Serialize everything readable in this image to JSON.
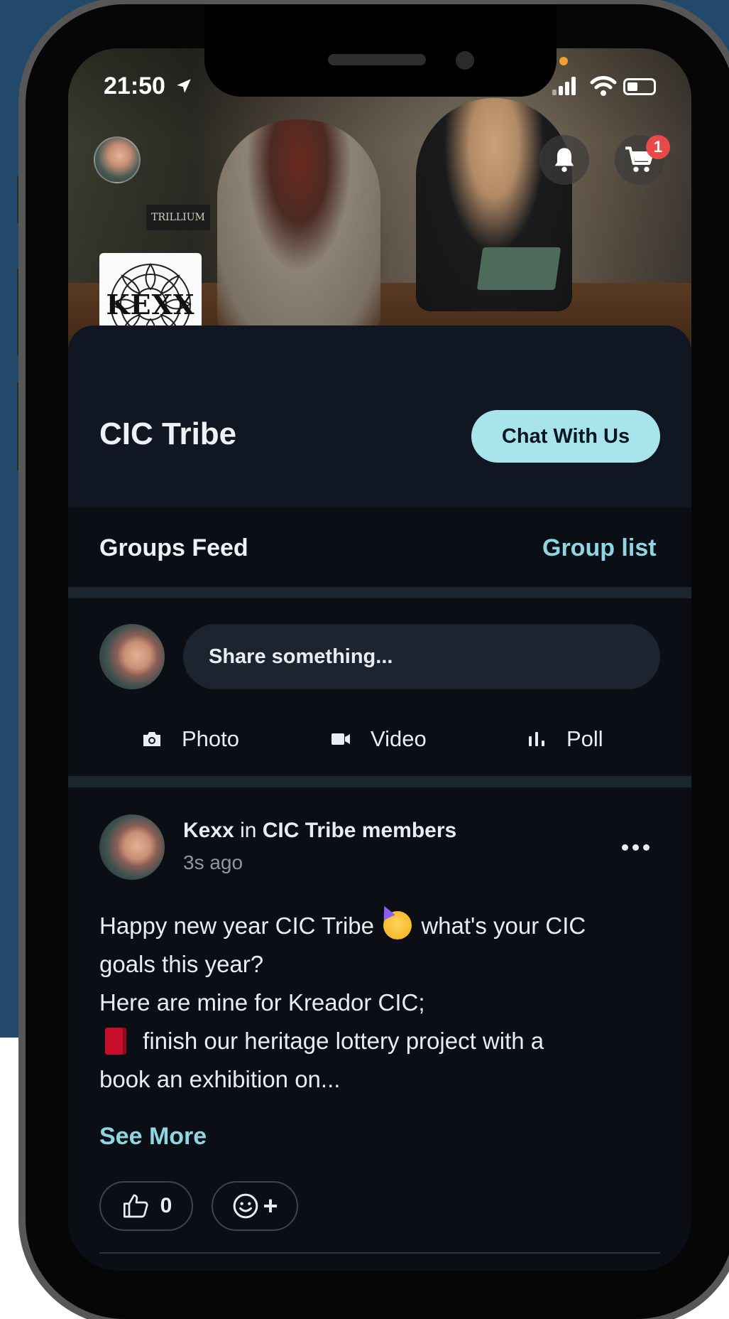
{
  "status_bar": {
    "time": "21:50"
  },
  "cover": {
    "sign_text": "TRILLIUM"
  },
  "header": {
    "cart_badge": "1",
    "logo_text": "KEXX"
  },
  "community": {
    "name": "CIC Tribe",
    "chat_button_label": "Chat With Us"
  },
  "tabs": {
    "groups_feed_label": "Groups Feed",
    "group_list_label": "Group list"
  },
  "composer": {
    "placeholder": "Share something...",
    "actions": [
      {
        "label": "Photo",
        "icon": "camera-icon"
      },
      {
        "label": "Video",
        "icon": "video-camera-icon"
      },
      {
        "label": "Poll",
        "icon": "poll-bars-icon"
      }
    ]
  },
  "post": {
    "author": "Kexx",
    "in_word": "in",
    "group": "CIC Tribe members",
    "time": "3s ago",
    "text_lines": [
      {
        "before": "Happy new year CIC Tribe",
        "after": "what's your CIC"
      },
      "goals this year?",
      "Here are mine for Kreador CIC;",
      {
        "after": "finish our heritage lottery project with a"
      },
      "book an exhibition on..."
    ],
    "see_more_label": "See More",
    "like_count": "0",
    "add_reaction_label": "+"
  },
  "colors": {
    "accent": "#a8e4ec",
    "link": "#8ed6e1",
    "background": "#0b0f15",
    "badge": "#e84a4a"
  }
}
